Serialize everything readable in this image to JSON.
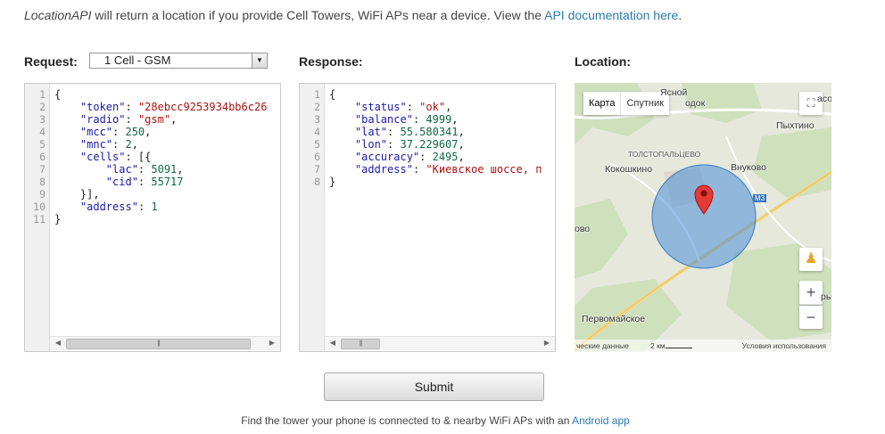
{
  "intro": {
    "api_name": "LocationAPI",
    "text": " will return a location if you provide Cell Towers, WiFi APs near a device. View the ",
    "link": "API documentation here",
    "suffix": "."
  },
  "request": {
    "label": "Request:",
    "select_value": "1 Cell - GSM",
    "line_numbers": "1\n2\n3\n4\n5\n6\n7\n8\n9\n10\n11"
  },
  "response": {
    "label": "Response:",
    "line_numbers": "1\n2\n3\n4\n5\n6\n7\n8"
  },
  "location": {
    "label": "Location:"
  },
  "map": {
    "type_active": "Карта",
    "type_other": "Спутник",
    "places": {
      "top_a": "Ясной",
      "top_b": "одок",
      "pykhtino": "Пыхтино",
      "tolstopaltsevo": "ТОЛСТОПАЛЬЦЕВО",
      "kokoshkino": "Кокошкино",
      "vnukovo": "Внуково",
      "road": "М3",
      "left_edge": "ово",
      "right_edge": "ры",
      "pervomaiskoe": "Первомайское",
      "top_right": "асо"
    },
    "attribution": {
      "left": "ческие данные",
      "scale": "2 км",
      "terms": "Условия использования"
    },
    "accent_circle": "#4a8fdb"
  },
  "submit_label": "Submit",
  "footer": {
    "text": "Find the tower your phone is connected to & nearby WiFi APs with an ",
    "link": "Android app"
  }
}
